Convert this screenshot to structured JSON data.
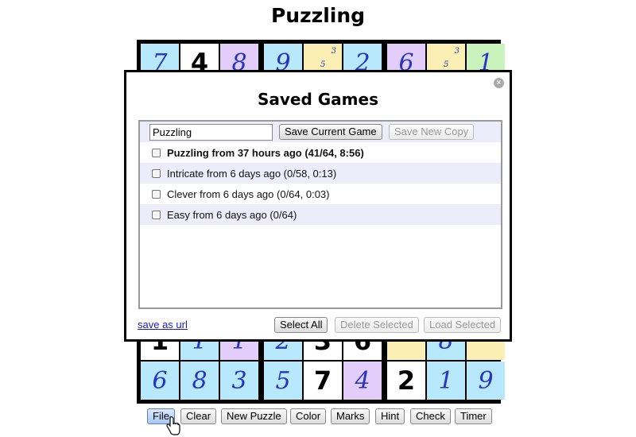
{
  "page": {
    "title": "Puzzling"
  },
  "board_visible": {
    "top_row": [
      {
        "value": "7",
        "kind": "hand",
        "bg": "#b8e8fb"
      },
      {
        "value": "4",
        "kind": "given",
        "bg": "#ffffff"
      },
      {
        "value": "8",
        "kind": "hand",
        "bg": "#e2cdfb"
      },
      {
        "value": "9",
        "kind": "hand",
        "bg": "#b8e8fb"
      },
      {
        "value": "",
        "kind": "notes",
        "notes_tr": "3",
        "notes_c": "5",
        "bg": "#fcefb3"
      },
      {
        "value": "2",
        "kind": "hand",
        "bg": "#b8e8fb"
      },
      {
        "value": "6",
        "kind": "hand",
        "bg": "#e2cdfb"
      },
      {
        "value": "",
        "kind": "notes",
        "notes_tr": "3",
        "notes_c": "5",
        "bg": "#fcefb3"
      },
      {
        "value": "1",
        "kind": "hand",
        "bg": "#c9f3bd"
      }
    ],
    "second_last_row": [
      {
        "value": "1",
        "kind": "given",
        "bg": "#ffffff"
      },
      {
        "value": "1",
        "kind": "hand",
        "bg": "#b8e8fb"
      },
      {
        "value": "1",
        "kind": "hand",
        "bg": "#e2cdfb"
      },
      {
        "value": "2",
        "kind": "hand",
        "bg": "#b8e8fb"
      },
      {
        "value": "3",
        "kind": "given",
        "bg": "#ffffff"
      },
      {
        "value": "6",
        "kind": "given",
        "bg": "#ffffff"
      },
      {
        "value": "",
        "kind": "empty",
        "bg": "#fcefb3"
      },
      {
        "value": "8",
        "kind": "hand",
        "bg": "#b8e8fb"
      },
      {
        "value": "",
        "kind": "empty",
        "bg": "#fcefb3"
      }
    ],
    "last_row": [
      {
        "value": "6",
        "kind": "hand",
        "bg": "#b8e8fb"
      },
      {
        "value": "8",
        "kind": "hand",
        "bg": "#b8e8fb"
      },
      {
        "value": "3",
        "kind": "hand",
        "bg": "#b8e8fb"
      },
      {
        "value": "5",
        "kind": "hand",
        "bg": "#b8e8fb"
      },
      {
        "value": "7",
        "kind": "given",
        "bg": "#ffffff"
      },
      {
        "value": "4",
        "kind": "hand",
        "bg": "#e2cdfb"
      },
      {
        "value": "2",
        "kind": "given",
        "bg": "#ffffff"
      },
      {
        "value": "1",
        "kind": "hand",
        "bg": "#b8e8fb"
      },
      {
        "value": "9",
        "kind": "hand",
        "bg": "#b8e8fb"
      }
    ]
  },
  "dialog": {
    "title": "Saved Games",
    "name_input_value": "Puzzling",
    "save_current_label": "Save Current Game",
    "save_new_copy_label": "Save New Copy",
    "games": [
      {
        "label": "Puzzling from 37 hours ago (41/64, 8:56)",
        "bold": true
      },
      {
        "label": "Intricate from 6 days ago (0/58, 0:13)",
        "bold": false
      },
      {
        "label": "Clever from 6 days ago (0/64, 0:03)",
        "bold": false
      },
      {
        "label": "Easy from 6 days ago (0/64)",
        "bold": false
      }
    ],
    "save_as_url_label": "save as url",
    "select_all_label": "Select All",
    "delete_selected_label": "Delete Selected",
    "load_selected_label": "Load Selected",
    "close_icon": "close-circle-icon"
  },
  "toolbar": {
    "file": "File",
    "clear": "Clear",
    "new_puzzle": "New Puzzle",
    "color": "Color",
    "marks": "Marks",
    "hint": "Hint",
    "check": "Check",
    "timer": "Timer"
  },
  "colors": {
    "blue": "#b8e8fb",
    "purple": "#e2cdfb",
    "yellow": "#fcefb3",
    "green": "#c9f3bd",
    "ink": "#2633c4"
  }
}
